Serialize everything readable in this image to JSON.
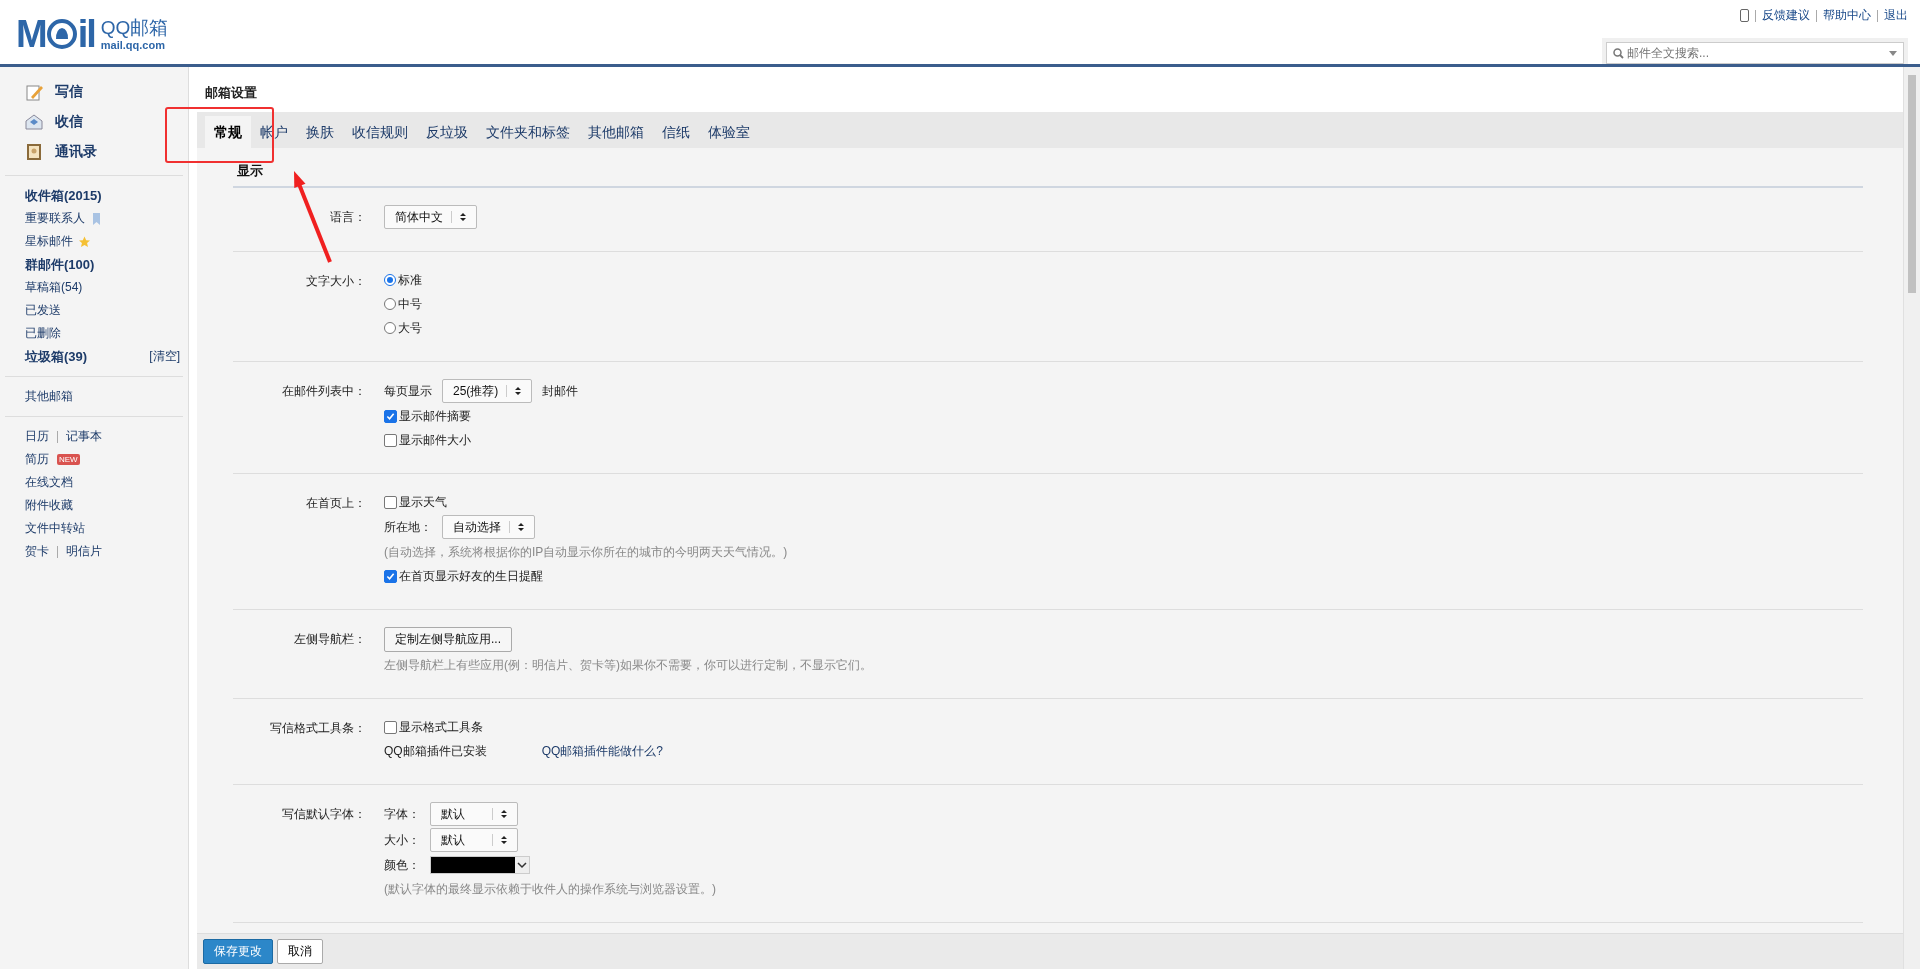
{
  "header": {
    "logo": {
      "left": "M",
      "right": "il",
      "name": "QQ邮箱",
      "domain": "mail.qq.com"
    },
    "top_links": [
      "反馈建议",
      "帮助中心",
      "退出"
    ],
    "search": {
      "placeholder": "邮件全文搜索..."
    }
  },
  "sidebar": {
    "actions": [
      "写信",
      "收信",
      "通讯录"
    ],
    "folders": [
      {
        "label": "收件箱(2015)",
        "bold": true,
        "kind": "plain"
      },
      {
        "label": "重要联系人",
        "bold": false,
        "kind": "bookmark"
      },
      {
        "label": "星标邮件",
        "bold": false,
        "kind": "star"
      },
      {
        "label": "群邮件(100)",
        "bold": true,
        "kind": "plain"
      },
      {
        "label": "草稿箱(54)",
        "bold": false,
        "kind": "plain"
      },
      {
        "label": "已发送",
        "bold": false,
        "kind": "plain"
      },
      {
        "label": "已删除",
        "bold": false,
        "kind": "plain"
      },
      {
        "label": "垃圾箱(39)",
        "bold": true,
        "kind": "plain",
        "action": "[清空]"
      }
    ],
    "other": "其他邮箱",
    "apps": [
      {
        "links": [
          "日历",
          "记事本"
        ]
      },
      {
        "links": [
          "简历"
        ],
        "badge": "NEW"
      },
      {
        "links": [
          "在线文档"
        ]
      },
      {
        "links": [
          "附件收藏"
        ]
      },
      {
        "links": [
          "文件中转站"
        ]
      },
      {
        "links": [
          "贺卡",
          "明信片"
        ]
      }
    ]
  },
  "settings": {
    "title": "邮箱设置",
    "tabs": [
      {
        "label": "常规",
        "selected": true
      },
      {
        "label": "帐户",
        "selected": false
      },
      {
        "label": "换肤",
        "selected": false
      },
      {
        "label": "收信规则",
        "selected": false
      },
      {
        "label": "反垃圾",
        "selected": false
      },
      {
        "label": "文件夹和标签",
        "selected": false
      },
      {
        "label": "其他邮箱",
        "selected": false
      },
      {
        "label": "信纸",
        "selected": false
      },
      {
        "label": "体验室",
        "selected": false
      }
    ],
    "section": "显示",
    "rows": [
      {
        "label": "语言：",
        "lines": [
          [
            {
              "kind": "select",
              "value": "简体中文"
            }
          ]
        ]
      },
      {
        "label": "文字大小：",
        "lines": [
          [
            {
              "kind": "radio",
              "label": "标准",
              "selected": true
            }
          ],
          [
            {
              "kind": "radio",
              "label": "中号",
              "selected": false
            }
          ],
          [
            {
              "kind": "radio",
              "label": "大号",
              "selected": false
            }
          ]
        ]
      },
      {
        "label": "在邮件列表中：",
        "lines": [
          [
            {
              "kind": "text",
              "text": "每页显示"
            },
            {
              "kind": "select",
              "value": "25(推荐)"
            },
            {
              "kind": "text",
              "text": "封邮件"
            }
          ],
          [
            {
              "kind": "checkbox",
              "label": "显示邮件摘要",
              "checked": true
            }
          ],
          [
            {
              "kind": "checkbox",
              "label": "显示邮件大小",
              "checked": false
            }
          ]
        ]
      },
      {
        "label": "在首页上：",
        "lines": [
          [
            {
              "kind": "checkbox",
              "label": "显示天气",
              "checked": false
            }
          ],
          [
            {
              "kind": "text",
              "text": "所在地："
            },
            {
              "kind": "select",
              "value": "自动选择"
            }
          ],
          [
            {
              "kind": "hint",
              "text": "(自动选择，系统将根据你的IP自动显示你所在的城市的今明两天天气情况。)"
            }
          ],
          [
            {
              "kind": "checkbox",
              "label": "在首页显示好友的生日提醒",
              "checked": true
            }
          ]
        ]
      },
      {
        "label": "左侧导航栏：",
        "lines": [
          [
            {
              "kind": "button",
              "label": "定制左侧导航应用..."
            }
          ],
          [
            {
              "kind": "hint",
              "text": "左侧导航栏上有些应用(例：明信片、贺卡等)如果你不需要，你可以进行定制，不显示它们。"
            }
          ]
        ]
      },
      {
        "label": "写信格式工具条：",
        "lines": [
          [
            {
              "kind": "checkbox",
              "label": "显示格式工具条",
              "checked": false
            }
          ],
          [
            {
              "kind": "text",
              "text": "QQ邮箱插件已安装"
            },
            {
              "kind": "link",
              "text": "QQ邮箱插件能做什么?"
            }
          ]
        ]
      },
      {
        "label": "写信默认字体：",
        "lines": [
          [
            {
              "kind": "text",
              "text": "字体："
            },
            {
              "kind": "select",
              "value": "默认"
            }
          ],
          [
            {
              "kind": "text",
              "text": "大小："
            },
            {
              "kind": "select",
              "value": "默认"
            }
          ],
          [
            {
              "kind": "text",
              "text": "颜色："
            },
            {
              "kind": "color",
              "color": "#000000"
            }
          ],
          [
            {
              "kind": "hint",
              "text": "(默认字体的最终显示依赖于收件人的操作系统与浏览器设置。)"
            }
          ]
        ]
      }
    ],
    "buttons": [
      {
        "label": "保存更改",
        "kind": "primary"
      },
      {
        "label": "取消",
        "kind": "plain"
      }
    ]
  },
  "annotations": {
    "highlight_box": true,
    "arrow": true
  }
}
